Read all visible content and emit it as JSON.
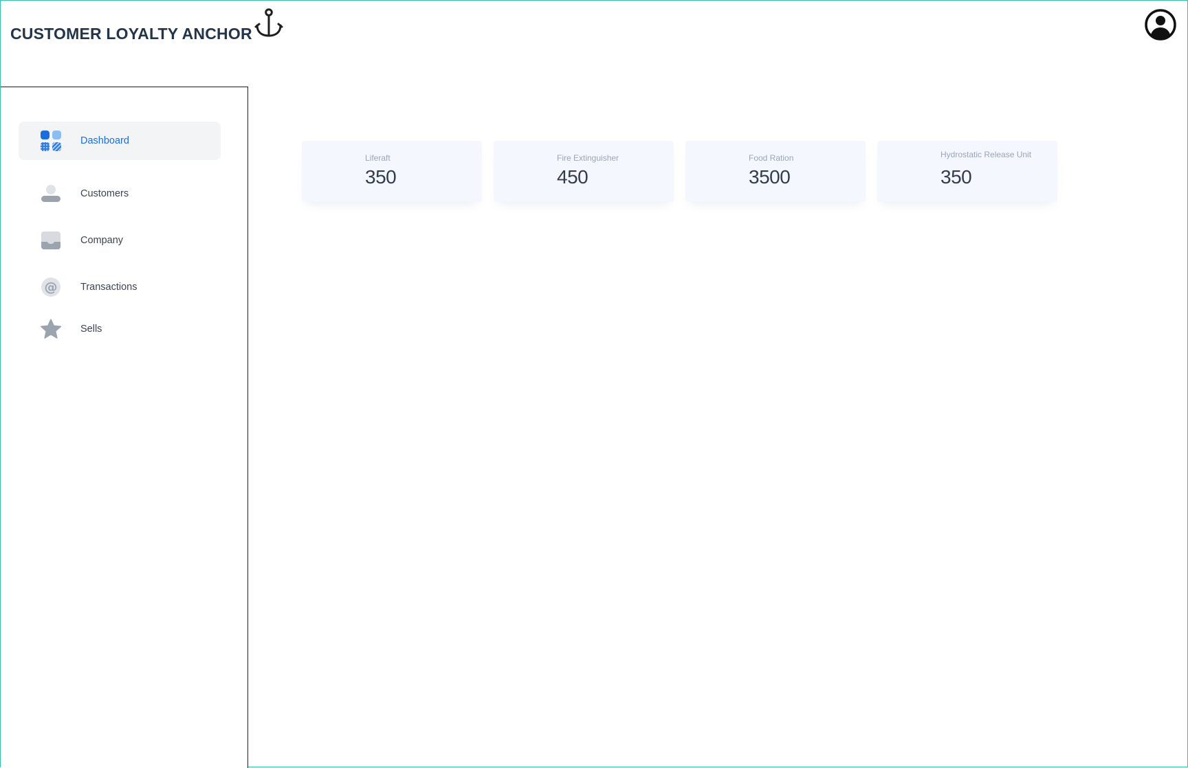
{
  "brand": {
    "title": "CUSTOMER LOYALTY ANCHOR",
    "logo_icon": "anchor-icon",
    "text_color": "#23354a"
  },
  "header": {
    "profile_icon": "user-circle-icon"
  },
  "sidebar": {
    "items": [
      {
        "label": "Dashboard",
        "icon": "dashboard-grid-icon",
        "active": true
      },
      {
        "label": "Customers",
        "icon": "user-icon",
        "active": false
      },
      {
        "label": "Company",
        "icon": "inbox-icon",
        "active": false
      },
      {
        "label": "Transactions",
        "icon": "at-sign-icon",
        "active": false
      },
      {
        "label": "Sells",
        "icon": "star-icon",
        "active": false
      }
    ],
    "active_color": "#1a6ee0",
    "active_background": "#f3f4f6"
  },
  "stats": [
    {
      "label": "Liferaft",
      "value": "350"
    },
    {
      "label": "Fire Extinguisher",
      "value": "450"
    },
    {
      "label": "Food Ration",
      "value": "3500"
    },
    {
      "label": "Hydrostatic Release Unit",
      "value": "350"
    }
  ],
  "colors": {
    "frame_border": "#2ec4a6",
    "card_background": "#f4f7fd"
  }
}
